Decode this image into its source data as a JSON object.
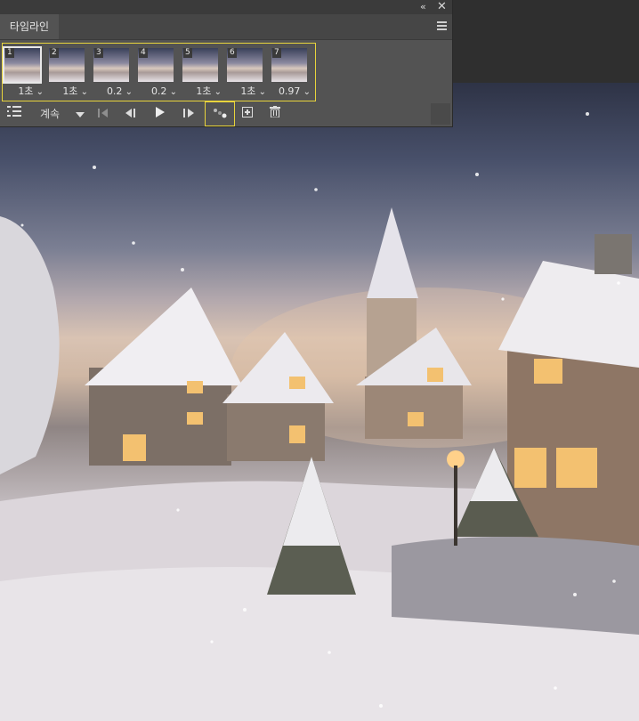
{
  "panel": {
    "collapse_icon": "double-chevron-left-icon",
    "close_icon": "close-icon",
    "tab_label": "타임라인",
    "menu_icon": "panel-menu-icon"
  },
  "frames": [
    {
      "num": "1",
      "delay": "1초",
      "selected": true
    },
    {
      "num": "2",
      "delay": "1초",
      "selected": false
    },
    {
      "num": "3",
      "delay": "0.2",
      "selected": false
    },
    {
      "num": "4",
      "delay": "0.2",
      "selected": false
    },
    {
      "num": "5",
      "delay": "1초",
      "selected": false
    },
    {
      "num": "6",
      "delay": "1초",
      "selected": false
    },
    {
      "num": "7",
      "delay": "0.97",
      "selected": false
    }
  ],
  "toolbar": {
    "loop_label": "계속",
    "icons": [
      "convert-timeline-icon",
      "loop-dropdown-icon",
      "first-frame-icon",
      "previous-frame-icon",
      "play-icon",
      "next-frame-icon",
      "tween-icon",
      "duplicate-frame-icon",
      "delete-frame-icon"
    ]
  },
  "colors": {
    "highlight": "#e8d43c",
    "panel_bg": "#535353"
  }
}
